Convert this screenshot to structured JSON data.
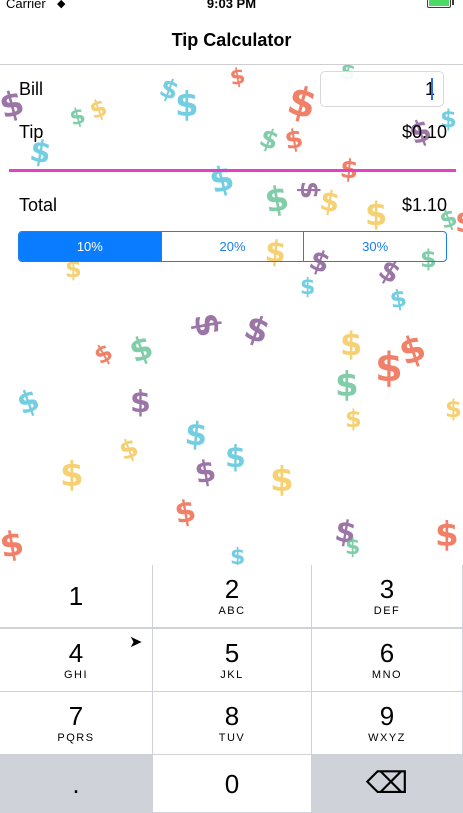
{
  "status_bar": {
    "carrier": "Carrier",
    "time": "9:03 PM"
  },
  "nav": {
    "title": "Tip Calculator"
  },
  "form": {
    "bill_label": "Bill",
    "bill_value": "1",
    "tip_label": "Tip",
    "tip_value": "$0.10",
    "total_label": "Total",
    "total_value": "$1.10"
  },
  "tip_segments": [
    {
      "label": "10%",
      "selected": true
    },
    {
      "label": "20%",
      "selected": false
    },
    {
      "label": "30%",
      "selected": false
    }
  ],
  "colors": {
    "accent": "#0a7cff",
    "divider": "#e83ec3",
    "dollar_palette": [
      "#5bc6dc",
      "#f4c95b",
      "#ef6a4e",
      "#8a5e97",
      "#6cc59b"
    ]
  },
  "keyboard": {
    "keys": [
      {
        "digit": "1",
        "letters": ""
      },
      {
        "digit": "2",
        "letters": "ABC"
      },
      {
        "digit": "3",
        "letters": "DEF"
      },
      {
        "digit": "4",
        "letters": "GHI"
      },
      {
        "digit": "5",
        "letters": "JKL"
      },
      {
        "digit": "6",
        "letters": "MNO"
      },
      {
        "digit": "7",
        "letters": "PQRS"
      },
      {
        "digit": "8",
        "letters": "TUV"
      },
      {
        "digit": "9",
        "letters": "WXYZ"
      },
      {
        "digit": ".",
        "letters": ""
      },
      {
        "digit": "0",
        "letters": ""
      },
      {
        "digit": "⌫",
        "letters": ""
      }
    ]
  }
}
